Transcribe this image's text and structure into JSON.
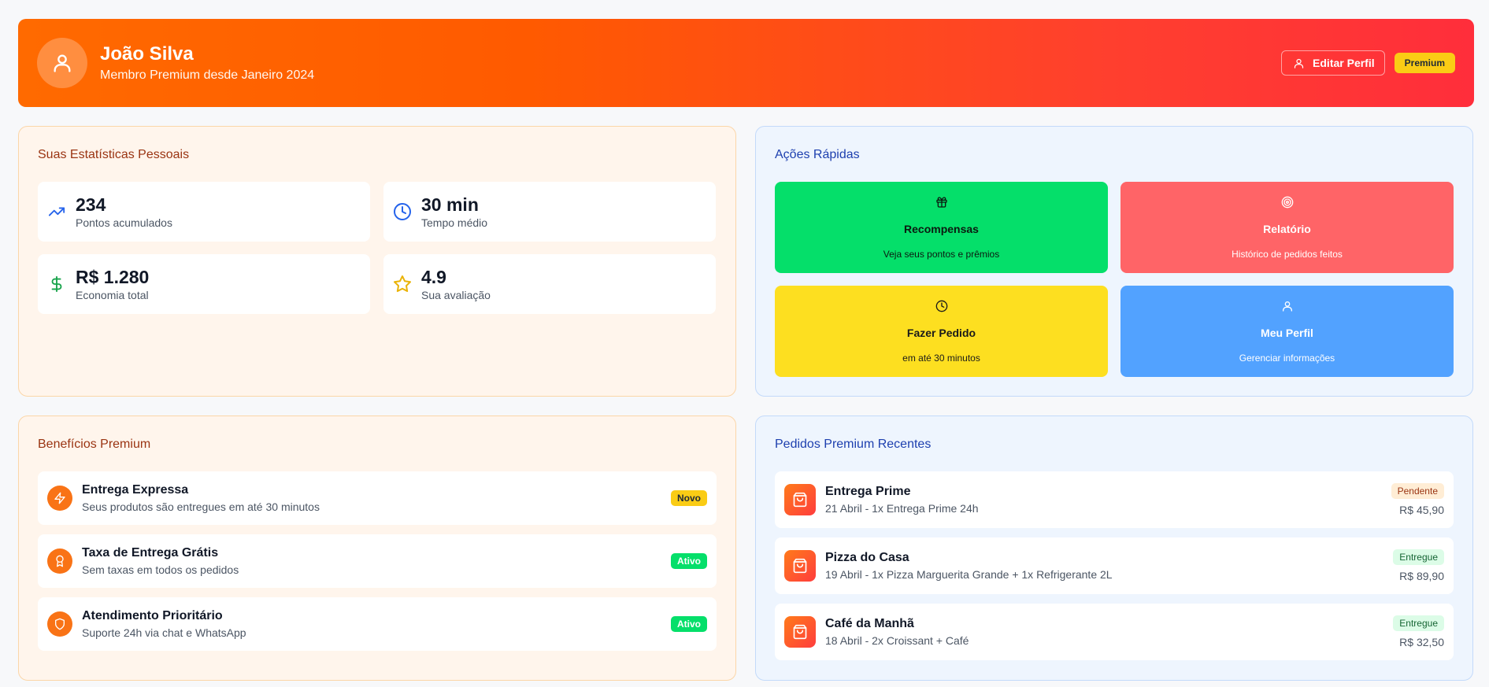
{
  "header": {
    "name": "João Silva",
    "membership": "Membro Premium desde Janeiro 2024",
    "edit_label": "Editar Perfil",
    "badge": "Premium",
    "icons": {
      "avatar": "user-icon",
      "edit": "user-icon"
    }
  },
  "stats": {
    "title": "Suas Estatísticas Pessoais",
    "items": [
      {
        "value": "234",
        "label": "Pontos acumulados",
        "icon": "trending-up-icon",
        "color": "#2563eb"
      },
      {
        "value": "30 min",
        "label": "Tempo médio",
        "icon": "clock-icon",
        "color": "#2563eb"
      },
      {
        "value": "R$ 1.280",
        "label": "Economia total",
        "icon": "dollar-icon",
        "color": "#16a34a"
      },
      {
        "value": "4.9",
        "label": "Sua avaliação",
        "icon": "star-icon",
        "color": "#eab308"
      }
    ]
  },
  "actions": {
    "title": "Ações Rápidas",
    "items": [
      {
        "title": "Recompensas",
        "subtitle": "Veja seus pontos e prêmios",
        "icon": "gift-icon",
        "color": "#05df6a"
      },
      {
        "title": "Relatório",
        "subtitle": "Histórico de pedidos feitos",
        "icon": "target-icon",
        "color": "#ff6467"
      },
      {
        "title": "Fazer Pedido",
        "subtitle": "em até 30 minutos",
        "icon": "clock-icon",
        "color": "#fddf20"
      },
      {
        "title": "Meu Perfil",
        "subtitle": "Gerenciar informações",
        "icon": "user-icon",
        "color": "#52a2ff"
      }
    ]
  },
  "benefits": {
    "title": "Benefícios Premium",
    "items": [
      {
        "title": "Entrega Expressa",
        "subtitle": "Seus produtos são entregues em até 30 minutos",
        "tag": "Novo",
        "icon": "lightning-icon"
      },
      {
        "title": "Taxa de Entrega Grátis",
        "subtitle": "Sem taxas em todos os pedidos",
        "tag": "Ativo",
        "icon": "award-icon"
      },
      {
        "title": "Atendimento Prioritário",
        "subtitle": "Suporte 24h via chat e WhatsApp",
        "tag": "Ativo",
        "icon": "shield-icon"
      }
    ]
  },
  "orders": {
    "title": "Pedidos Premium Recentes",
    "items": [
      {
        "title": "Entrega Prime",
        "details": "21 Abril - 1x Entrega Prime 24h",
        "status": "Pendente",
        "price": "R$ 45,90",
        "icon": "shopping-bag-icon"
      },
      {
        "title": "Pizza do Casa",
        "details": "19 Abril - 1x Pizza Marguerita Grande + 1x Refrigerante 2L",
        "status": "Entregue",
        "price": "R$ 89,90",
        "icon": "shopping-bag-icon"
      },
      {
        "title": "Café da Manhã",
        "details": "18 Abril - 2x Croissant + Café",
        "status": "Entregue",
        "price": "R$ 32,50",
        "icon": "shopping-bag-icon"
      }
    ]
  }
}
